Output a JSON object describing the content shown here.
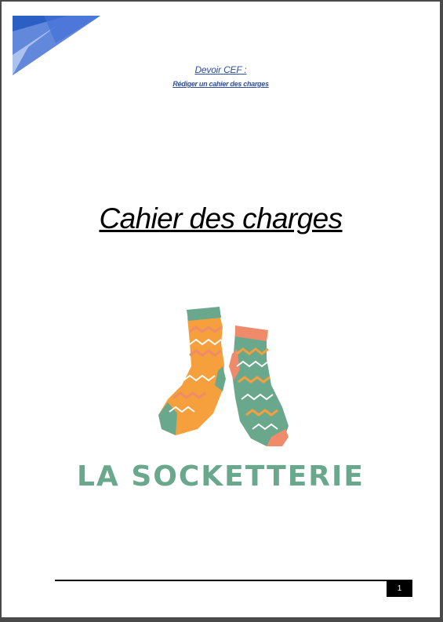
{
  "document": {
    "header_line1": "Devoir CEF :",
    "header_line2": "Rédiger un cahier des charges",
    "title": "Cahier des charges",
    "brand_name": "LA SOCKETTERIE",
    "page_number": "1"
  },
  "colors": {
    "header_text": "#2f4f9e",
    "sock_orange": "#f5a03c",
    "sock_green": "#6aa88e",
    "sock_coral": "#ef8a6a",
    "brand_text": "#6aa88e"
  },
  "icons": [
    "corner-triangle-decoration",
    "socks-logo-icon"
  ]
}
